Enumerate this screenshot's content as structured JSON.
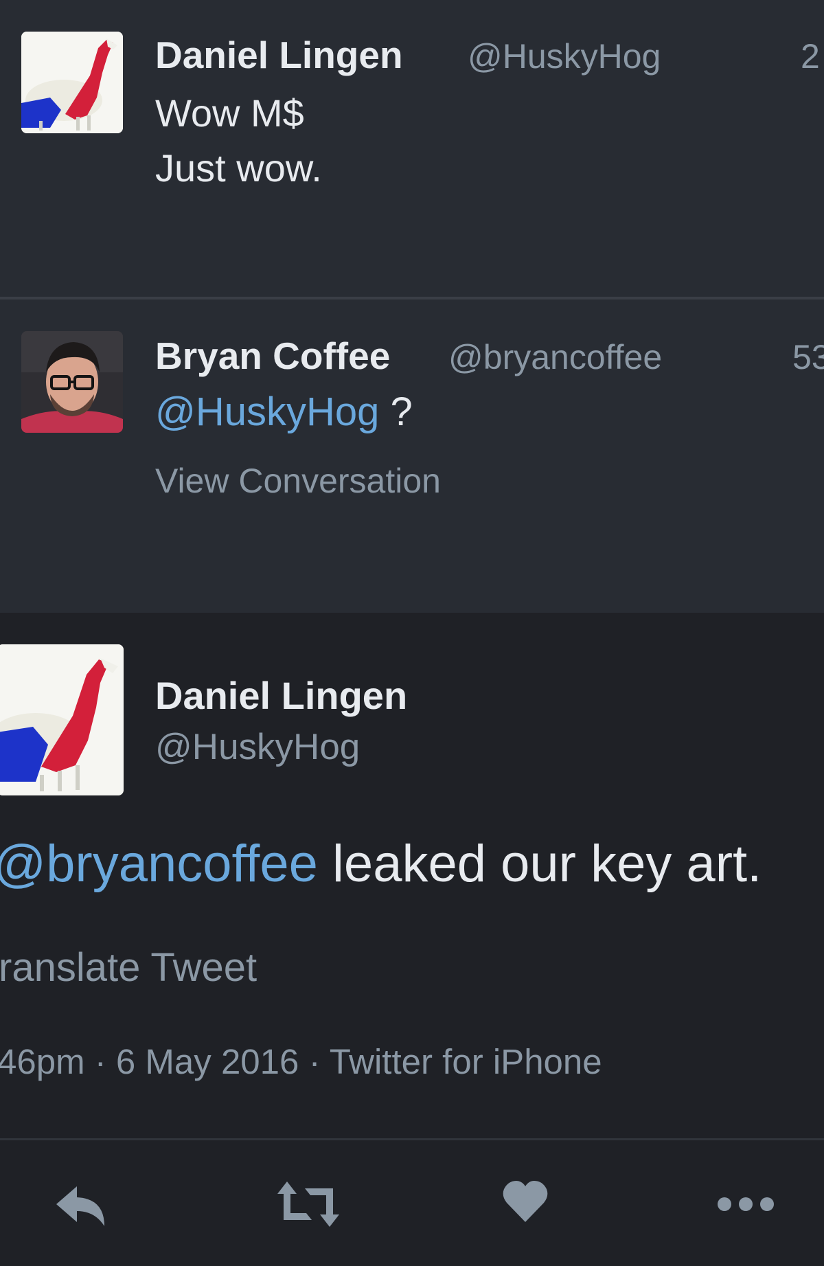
{
  "tweets": [
    {
      "name": "Daniel Lingen",
      "handle": "@HuskyHog",
      "time": "2",
      "lines": [
        "Wow M$",
        "Just wow."
      ]
    },
    {
      "name": "Bryan Coffee",
      "handle": "@bryancoffee",
      "time": "53",
      "mention": "@HuskyHog",
      "text_after": " ?",
      "view_conversation": "View Conversation"
    }
  ],
  "main_tweet": {
    "name": "Daniel Lingen",
    "handle": "@HuskyHog",
    "mention": "@bryancoffee",
    "text_after": " leaked our key art.",
    "translate": "ranslate Tweet",
    "meta": "46pm · 6 May 2016 · Twitter for iPhone",
    "actions": [
      "reply-icon",
      "retweet-icon",
      "like-icon",
      "more-icon"
    ]
  },
  "colors": {
    "background": "#282c33",
    "main_background": "#1f2126",
    "text": "#e8ebef",
    "muted": "#8b98a5",
    "link": "#6aa8dd",
    "icon": "#8b98a5"
  }
}
